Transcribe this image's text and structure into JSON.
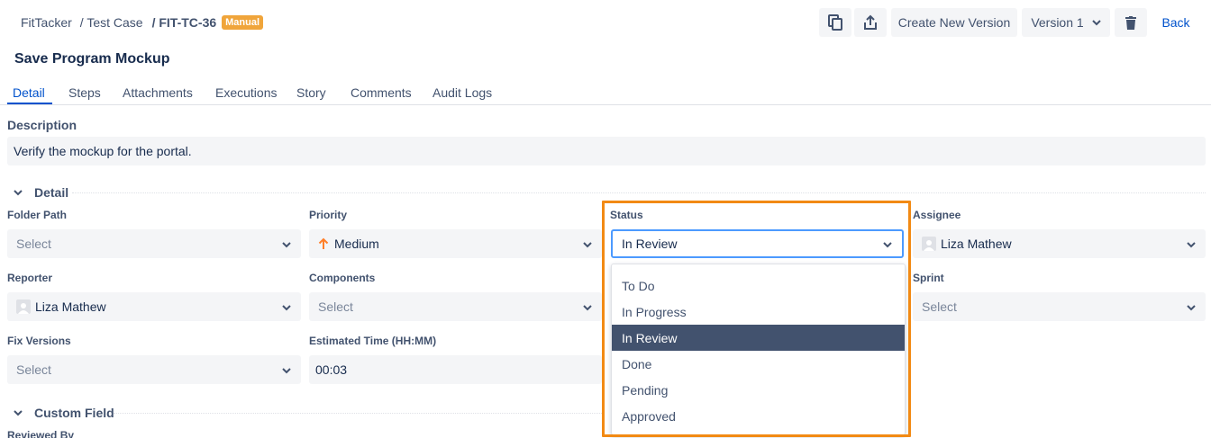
{
  "breadcrumb": {
    "project": "FitTacker",
    "section": "/ Test Case",
    "key": "/ FIT-TC-36",
    "badge": "Manual"
  },
  "toolbar": {
    "create_version": "Create New Version",
    "version": "Version 1",
    "back": "Back",
    "icons": [
      "copy-icon",
      "share-icon",
      "chevron-down-icon",
      "trash-icon"
    ]
  },
  "title": "Save Program Mockup",
  "tabs": [
    {
      "label": "Detail",
      "active": true
    },
    {
      "label": "Steps"
    },
    {
      "label": "Attachments"
    },
    {
      "label": "Executions"
    },
    {
      "label": "Story"
    },
    {
      "label": "Comments"
    },
    {
      "label": "Audit Logs"
    }
  ],
  "description": {
    "label": "Description",
    "text": "Verify the mockup for the portal."
  },
  "detail": {
    "heading": "Detail",
    "folder_path": {
      "label": "Folder Path",
      "placeholder": "Select"
    },
    "priority": {
      "label": "Priority",
      "value": "Medium"
    },
    "status": {
      "label": "Status",
      "value": "In Review"
    },
    "assignee": {
      "label": "Assignee",
      "value": "Liza Mathew"
    },
    "reporter": {
      "label": "Reporter",
      "value": "Liza Mathew"
    },
    "components": {
      "label": "Components",
      "placeholder": "Select"
    },
    "sprint": {
      "label": "Sprint",
      "placeholder": "Select"
    },
    "fix_versions": {
      "label": "Fix Versions",
      "placeholder": "Select"
    },
    "estimated_time": {
      "label": "Estimated Time (HH:MM)",
      "value": "00:03"
    }
  },
  "status_options": [
    "To Do",
    "In Progress",
    "In Review",
    "Done",
    "Pending",
    "Approved"
  ],
  "status_selected": "In Review",
  "custom_field": {
    "heading": "Custom Field",
    "reviewed_by_label": "Reviewed By"
  },
  "colors": {
    "accent": "#0052cc",
    "badge": "#f0a53b",
    "highlight": "#f28a14",
    "selected_option": "#42526e",
    "priority_arrow": "#ff7f28"
  }
}
